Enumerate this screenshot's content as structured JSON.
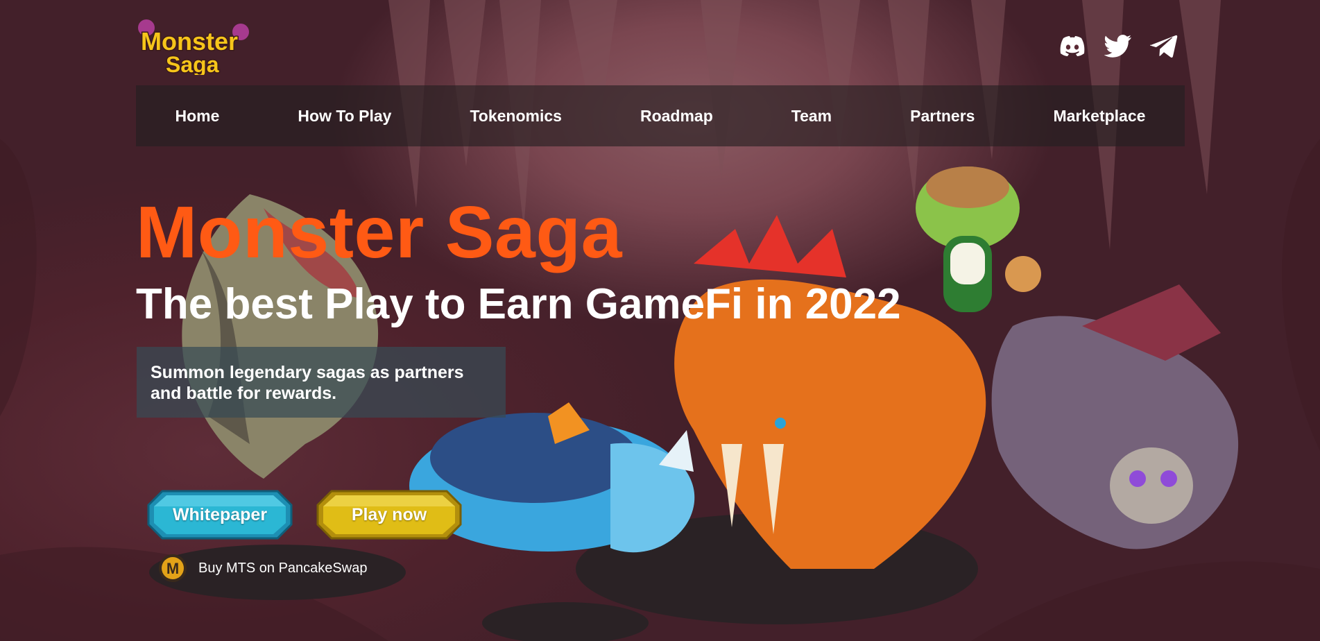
{
  "brand": {
    "logo_line1": "Monster",
    "logo_line2": "Saga"
  },
  "socials": [
    {
      "icon": "discord-icon"
    },
    {
      "icon": "twitter-icon"
    },
    {
      "icon": "telegram-icon"
    }
  ],
  "nav": {
    "items": [
      {
        "label": "Home"
      },
      {
        "label": "How To Play"
      },
      {
        "label": "Tokenomics"
      },
      {
        "label": "Roadmap"
      },
      {
        "label": "Team"
      },
      {
        "label": "Partners"
      },
      {
        "label": "Marketplace"
      }
    ]
  },
  "hero": {
    "title": "Monster Saga",
    "subtitle": "The best Play to Earn GameFi in 2022",
    "description": "Summon legendary sagas as partners and battle for rewards."
  },
  "buttons": {
    "whitepaper_label": "Whitepaper",
    "play_label": "Play now"
  },
  "buy": {
    "label": "Buy MTS on PancakeSwap",
    "coin_letter": "M"
  },
  "colors": {
    "accent_orange": "#ff5a14",
    "whitepaper_button": "#2bb7d4",
    "play_button": "#e0bd16",
    "nav_bg": "#231e20"
  }
}
